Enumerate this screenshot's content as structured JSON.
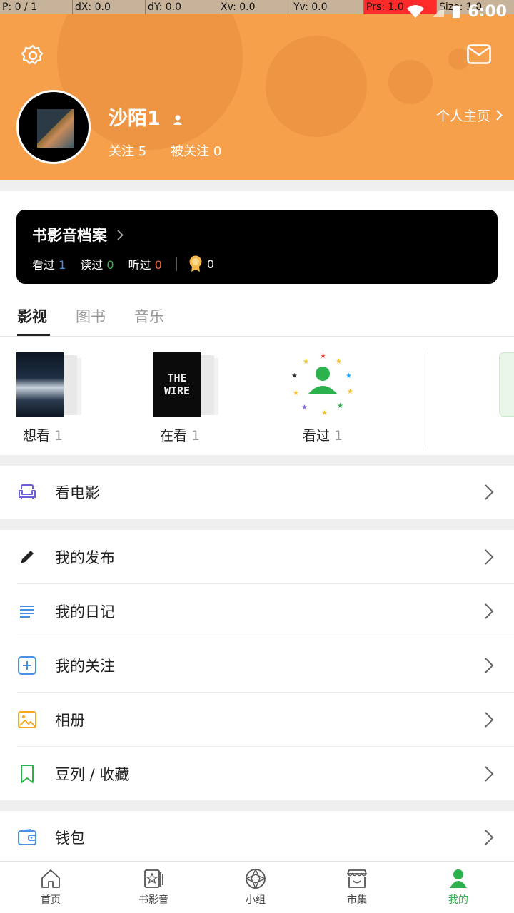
{
  "debug_bar": [
    "P: 0 / 1",
    "dX: 0.0",
    "dY: 0.0",
    "Xv: 0.0",
    "Yv: 0.0",
    "Prs: 1.0",
    "Size: 1.0"
  ],
  "status": {
    "time": "6:00"
  },
  "profile": {
    "username": "沙陌1",
    "home_link": "个人主页",
    "following_label": "关注",
    "following_count": "5",
    "followers_label": "被关注",
    "followers_count": "0"
  },
  "archive": {
    "title": "书影音档案",
    "stats": [
      {
        "label": "看过",
        "value": "1",
        "color": "#4a90e2"
      },
      {
        "label": "读过",
        "value": "0",
        "color": "#3cb54a"
      },
      {
        "label": "听过",
        "value": "0",
        "color": "#ff6a3d"
      }
    ],
    "badge_count": "0"
  },
  "tabs": [
    {
      "label": "影视",
      "active": true
    },
    {
      "label": "图书",
      "active": false
    },
    {
      "label": "音乐",
      "active": false
    }
  ],
  "shelves": [
    {
      "label": "想看",
      "count": "1"
    },
    {
      "label": "在看",
      "count": "1",
      "poster_text": "THE WIRE"
    },
    {
      "label": "看过",
      "count": "1"
    }
  ],
  "menu_groups": [
    [
      {
        "label": "看电影",
        "icon": "sofa-icon"
      }
    ],
    [
      {
        "label": "我的发布",
        "icon": "pencil-icon"
      },
      {
        "label": "我的日记",
        "icon": "lines-icon"
      },
      {
        "label": "我的关注",
        "icon": "plus-box-icon"
      },
      {
        "label": "相册",
        "icon": "image-icon"
      },
      {
        "label": "豆列 / 收藏",
        "icon": "bookmark-icon"
      }
    ],
    [
      {
        "label": "钱包",
        "icon": "wallet-icon"
      }
    ]
  ],
  "bottom_nav": [
    {
      "label": "首页",
      "icon": "home-icon",
      "active": false
    },
    {
      "label": "书影音",
      "icon": "media-icon",
      "active": false
    },
    {
      "label": "小组",
      "icon": "group-icon",
      "active": false
    },
    {
      "label": "市集",
      "icon": "market-icon",
      "active": false
    },
    {
      "label": "我的",
      "icon": "me-icon",
      "active": true
    }
  ],
  "colors": {
    "header": "#f7a04c",
    "accent_green": "#2bb24c",
    "card": "#000000"
  }
}
